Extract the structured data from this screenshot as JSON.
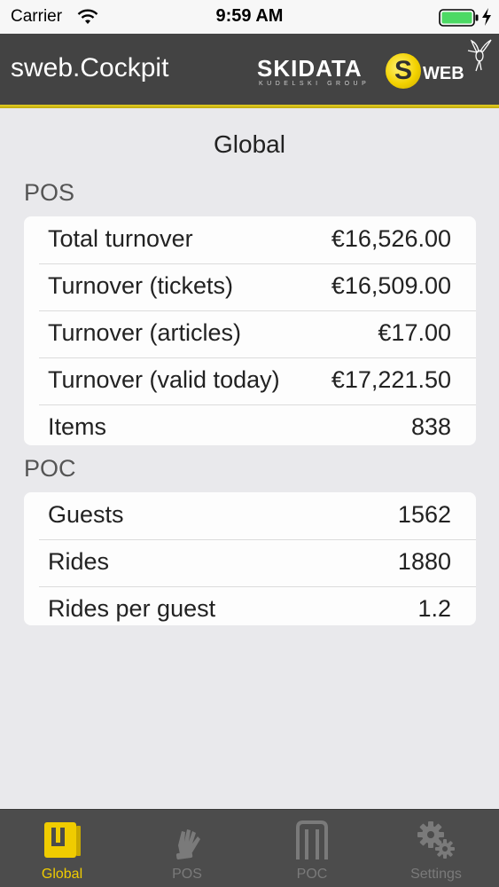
{
  "status_bar": {
    "carrier": "Carrier",
    "time": "9:59 AM",
    "icons": [
      "wifi-icon",
      "battery-icon",
      "charging-bolt-icon"
    ]
  },
  "nav_bar": {
    "title": "sweb.Cockpit",
    "logo": {
      "brand": "SKIDATA",
      "sub": "KUDELSKI GROUP",
      "badge": "S",
      "suffix": "WEB",
      "icon": "hummingbird-icon"
    }
  },
  "page": {
    "title": "Global"
  },
  "sections": [
    {
      "header": "POS",
      "rows": [
        {
          "label": "Total turnover",
          "value": "€16,526.00"
        },
        {
          "label": "Turnover (tickets)",
          "value": "€16,509.00"
        },
        {
          "label": "Turnover (articles)",
          "value": "€17.00"
        },
        {
          "label": "Turnover (valid today)",
          "value": "€17,221.50"
        },
        {
          "label": "Items",
          "value": "838"
        }
      ]
    },
    {
      "header": "POC",
      "rows": [
        {
          "label": "Guests",
          "value": "1562"
        },
        {
          "label": "Rides",
          "value": "1880"
        },
        {
          "label": "Rides per guest",
          "value": "1.2"
        }
      ]
    }
  ],
  "tab_bar": {
    "tabs": [
      {
        "label": "Global",
        "icon": "document-icon",
        "active": true
      },
      {
        "label": "POS",
        "icon": "glove-icon",
        "active": false
      },
      {
        "label": "POC",
        "icon": "gate-icon",
        "active": false
      },
      {
        "label": "Settings",
        "icon": "gears-icon",
        "active": false
      }
    ]
  },
  "colors": {
    "nav_background": "#434343",
    "accent": "#f0cc00",
    "page_background": "#e9e9ec",
    "tab_background": "#4c4c4c"
  }
}
